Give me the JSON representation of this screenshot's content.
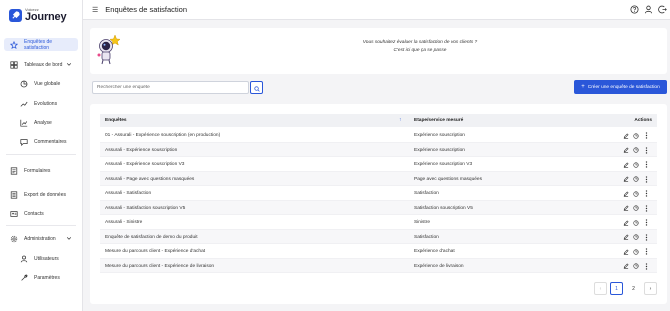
{
  "brand": {
    "small": "Voicezz",
    "name": "Journey",
    "accent": "#2a57d9"
  },
  "sidebar": {
    "items": [
      {
        "label": "Enquêtes de satisfaction",
        "icon": "star-icon",
        "active": true
      },
      {
        "label": "Tableaux de bord",
        "icon": "dashboard-icon",
        "expanded": true
      },
      {
        "label": "Vue globale",
        "icon": "pie-chart-icon",
        "sub": true
      },
      {
        "label": "Evolutions",
        "icon": "trend-icon",
        "sub": true
      },
      {
        "label": "Analyse",
        "icon": "line-chart-icon",
        "sub": true
      },
      {
        "label": "Commentaires",
        "icon": "comment-icon",
        "sub": true
      },
      {
        "label": "Formulaires",
        "icon": "form-icon"
      },
      {
        "label": "Export de données",
        "icon": "export-icon"
      },
      {
        "label": "Contacts",
        "icon": "contacts-icon"
      },
      {
        "label": "Administration",
        "icon": "gear-icon",
        "expanded": true
      },
      {
        "label": "Utilisateurs",
        "icon": "user-icon",
        "sub": true
      },
      {
        "label": "Paramètres",
        "icon": "wrench-icon",
        "sub": true
      }
    ]
  },
  "header": {
    "title": "Enquêtes de satisfaction"
  },
  "banner": {
    "question": "Vous souhaitez évaluer la satisfaction de vos clients ?",
    "answer": "C'est ici que ça se passe"
  },
  "search": {
    "placeholder": "Rechercher une enquête"
  },
  "create_button": {
    "label": "Créer une enquête de satisfaction"
  },
  "table": {
    "headers": {
      "name": "Enquêtes",
      "step": "Etape/service mesuré",
      "actions": "Actions"
    },
    "rows": [
      {
        "name": "01 - Assurali - Expérience souscription (en production)",
        "step": "Expérience souscription"
      },
      {
        "name": "Assurali - Expérience souscription",
        "step": "Expérience souscription"
      },
      {
        "name": "Assurali - Expérience souscription V3",
        "step": "Expérience souscription V3"
      },
      {
        "name": "Assurali - Page avec questions masquées",
        "step": "Page avec questions masquées"
      },
      {
        "name": "Assurali - Satisfaction",
        "step": "Satisfaction"
      },
      {
        "name": "Assurali - Satisfaction souscription V5",
        "step": "Satisfaction souscription V5"
      },
      {
        "name": "Assurali - Sinistre",
        "step": "Sinistre"
      },
      {
        "name": "Enquête de satisfaction de demo du produit",
        "step": "Satisfaction"
      },
      {
        "name": "Mesure du parcours client - Expérience d'achat",
        "step": "Expérience d'achat"
      },
      {
        "name": "Mesure du parcours client - Expérience de livraison",
        "step": "Expérience de livraison"
      }
    ]
  },
  "pagination": {
    "pages": [
      "1",
      "2"
    ],
    "current": "1"
  }
}
